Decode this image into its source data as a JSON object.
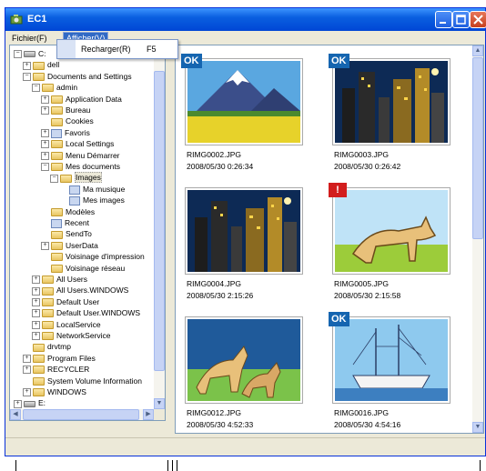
{
  "window": {
    "title": "EC1"
  },
  "menu": {
    "file": "Fichier(F)",
    "view": "Afficher(V)"
  },
  "dropdown": {
    "item": "Recharger(R)",
    "shortcut": "F5"
  },
  "tree": [
    {
      "label": "C:",
      "level": 0,
      "exp": "-",
      "icon": "drive"
    },
    {
      "label": "dell",
      "level": 1,
      "exp": "+",
      "icon": "folder"
    },
    {
      "label": "Documents and Settings",
      "level": 1,
      "exp": "-",
      "icon": "folder"
    },
    {
      "label": "admin",
      "level": 2,
      "exp": "-",
      "icon": "folder"
    },
    {
      "label": "Application Data",
      "level": 3,
      "exp": "+",
      "icon": "folder"
    },
    {
      "label": "Bureau",
      "level": 3,
      "exp": "+",
      "icon": "folder"
    },
    {
      "label": "Cookies",
      "level": 3,
      "exp": "",
      "icon": "folder"
    },
    {
      "label": "Favoris",
      "level": 3,
      "exp": "+",
      "icon": "special"
    },
    {
      "label": "Local Settings",
      "level": 3,
      "exp": "+",
      "icon": "folder"
    },
    {
      "label": "Menu Démarrer",
      "level": 3,
      "exp": "+",
      "icon": "folder"
    },
    {
      "label": "Mes documents",
      "level": 3,
      "exp": "-",
      "icon": "folder"
    },
    {
      "label": "Images",
      "level": 4,
      "exp": "-",
      "icon": "folder",
      "selected": true
    },
    {
      "label": "Ma musique",
      "level": 5,
      "exp": "",
      "icon": "special"
    },
    {
      "label": "Mes images",
      "level": 5,
      "exp": "",
      "icon": "special"
    },
    {
      "label": "Modèles",
      "level": 3,
      "exp": "",
      "icon": "folder"
    },
    {
      "label": "Recent",
      "level": 3,
      "exp": "",
      "icon": "special"
    },
    {
      "label": "SendTo",
      "level": 3,
      "exp": "",
      "icon": "folder"
    },
    {
      "label": "UserData",
      "level": 3,
      "exp": "+",
      "icon": "folder"
    },
    {
      "label": "Voisinage d'impression",
      "level": 3,
      "exp": "",
      "icon": "folder"
    },
    {
      "label": "Voisinage réseau",
      "level": 3,
      "exp": "",
      "icon": "folder"
    },
    {
      "label": "All Users",
      "level": 2,
      "exp": "+",
      "icon": "folder"
    },
    {
      "label": "All Users.WINDOWS",
      "level": 2,
      "exp": "+",
      "icon": "folder"
    },
    {
      "label": "Default User",
      "level": 2,
      "exp": "+",
      "icon": "folder"
    },
    {
      "label": "Default User.WINDOWS",
      "level": 2,
      "exp": "+",
      "icon": "folder"
    },
    {
      "label": "LocalService",
      "level": 2,
      "exp": "+",
      "icon": "folder"
    },
    {
      "label": "NetworkService",
      "level": 2,
      "exp": "+",
      "icon": "folder"
    },
    {
      "label": "drvtmp",
      "level": 1,
      "exp": "",
      "icon": "folder"
    },
    {
      "label": "Program Files",
      "level": 1,
      "exp": "+",
      "icon": "folder"
    },
    {
      "label": "RECYCLER",
      "level": 1,
      "exp": "+",
      "icon": "folder"
    },
    {
      "label": "System Volume Information",
      "level": 1,
      "exp": "",
      "icon": "folder"
    },
    {
      "label": "WINDOWS",
      "level": 1,
      "exp": "+",
      "icon": "folder"
    },
    {
      "label": "E:",
      "level": 0,
      "exp": "+",
      "icon": "drive"
    }
  ],
  "photos": [
    {
      "name": "RIMG0002.JPG",
      "date": "2008/05/30 0:26:34",
      "badge": "OK",
      "scene": "mountain"
    },
    {
      "name": "RIMG0003.JPG",
      "date": "2008/05/30 0:26:42",
      "badge": "OK",
      "scene": "city"
    },
    {
      "name": "RIMG0004.JPG",
      "date": "2008/05/30 2:15:26",
      "badge": "",
      "scene": "city"
    },
    {
      "name": "RIMG0005.JPG",
      "date": "2008/05/30 2:15:58",
      "badge": "!",
      "scene": "dog"
    },
    {
      "name": "RIMG0012.JPG",
      "date": "2008/05/30 4:52:33",
      "badge": "",
      "scene": "dogs"
    },
    {
      "name": "RIMG0016.JPG",
      "date": "2008/05/30 4:54:16",
      "badge": "OK",
      "scene": "ship"
    }
  ]
}
